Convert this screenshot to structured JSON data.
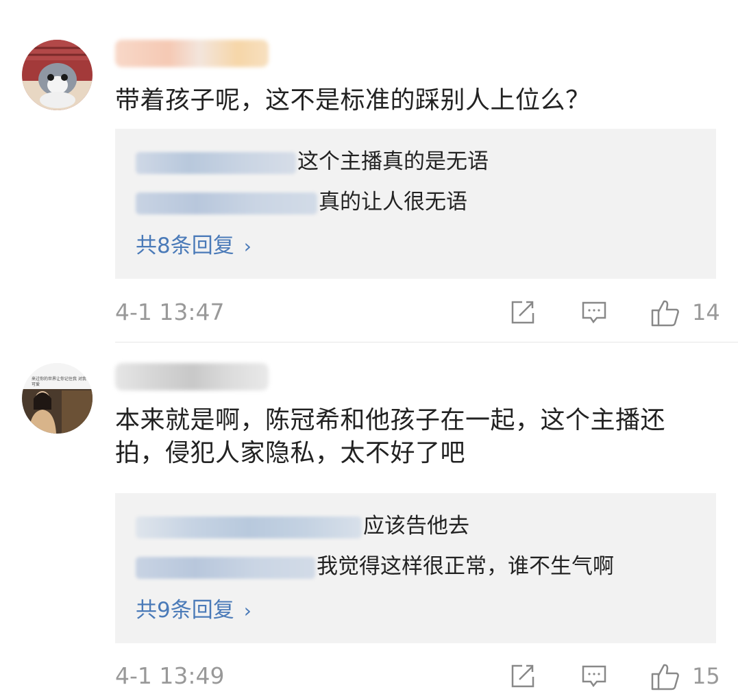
{
  "comments": [
    {
      "avatar": "cat-avatar",
      "text": "带着孩子呢，这不是标准的踩别人上位么？",
      "replies": [
        {
          "text": "这个主播真的是无语"
        },
        {
          "text": "真的让人很无语"
        }
      ],
      "more_replies": "共8条回复",
      "timestamp": "4-1 13:47",
      "likes": "14"
    },
    {
      "avatar": "girl-photo-avatar",
      "avatar_caption": "来过你的世界让你记住我 对我可爱",
      "text": "本来就是啊，陈冠希和他孩子在一起，这个主播还拍，侵犯人家隐私，太不好了吧",
      "replies": [
        {
          "text": "应该告他去"
        },
        {
          "text": "我觉得这样很正常，谁不生气啊"
        }
      ],
      "more_replies": "共9条回复",
      "timestamp": "4-1 13:49",
      "likes": "15"
    }
  ],
  "icons": {
    "share": "share-icon",
    "comment": "comment-icon",
    "like": "thumbs-up-icon",
    "chevron": "chevron-right-icon"
  },
  "colors": {
    "link": "#4a7ab8",
    "reply_bg": "#f2f2f2",
    "meta": "#999999"
  }
}
